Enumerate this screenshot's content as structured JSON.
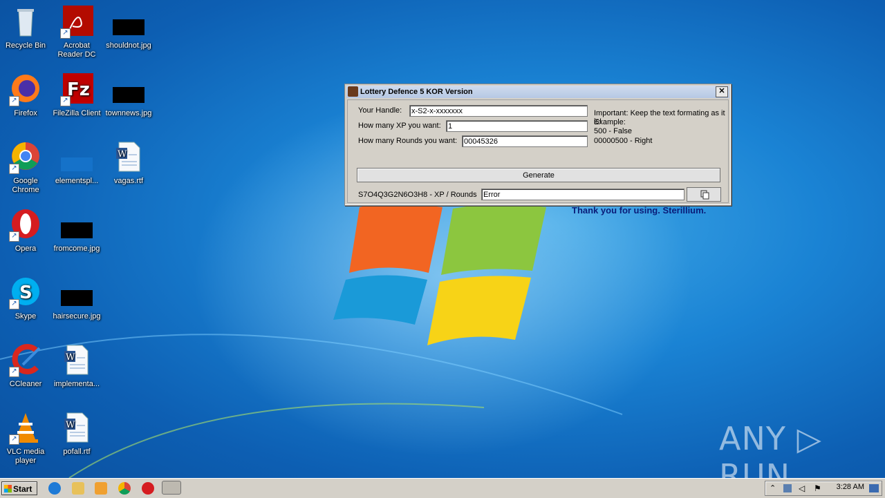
{
  "desktop": {
    "icons": [
      {
        "label": "Recycle Bin"
      },
      {
        "label": "Acrobat Reader DC"
      },
      {
        "label": "shouldnot.jpg"
      },
      {
        "label": "Firefox"
      },
      {
        "label": "FileZilla Client"
      },
      {
        "label": "townnews.jpg"
      },
      {
        "label": "Google Chrome"
      },
      {
        "label": "elementspl..."
      },
      {
        "label": "vagas.rtf"
      },
      {
        "label": "Opera"
      },
      {
        "label": "fromcome.jpg"
      },
      {
        "label": "Skype"
      },
      {
        "label": "hairsecure.jpg"
      },
      {
        "label": "CCleaner"
      },
      {
        "label": "implementa..."
      },
      {
        "label": "VLC media player"
      },
      {
        "label": "pofall.rtf"
      }
    ]
  },
  "dialog": {
    "title": "Lottery Defence 5 KOR Version",
    "close_label": "✕",
    "handle_label": "Your Handle:",
    "handle_value": "x-S2-x-xxxxxxx",
    "xp_label": "How many XP you want:",
    "xp_value": "1",
    "rounds_label": "How many Rounds you want:",
    "rounds_value": "00045326",
    "note_line1": "Important: Keep the text formating as it is!",
    "note_line2": "Example:",
    "note_line3": "500 - False",
    "note_line4": "00000500 - Right",
    "generate_label": "Generate",
    "code_label": "S7O4Q3G2N6O3H8 - XP / Rounds",
    "code_value": "Error",
    "thanks": "Thank you for using. Sterillium."
  },
  "taskbar": {
    "start_label": "Start",
    "clock": "3:28 AM"
  },
  "watermark": "ANY ▷ RUN"
}
